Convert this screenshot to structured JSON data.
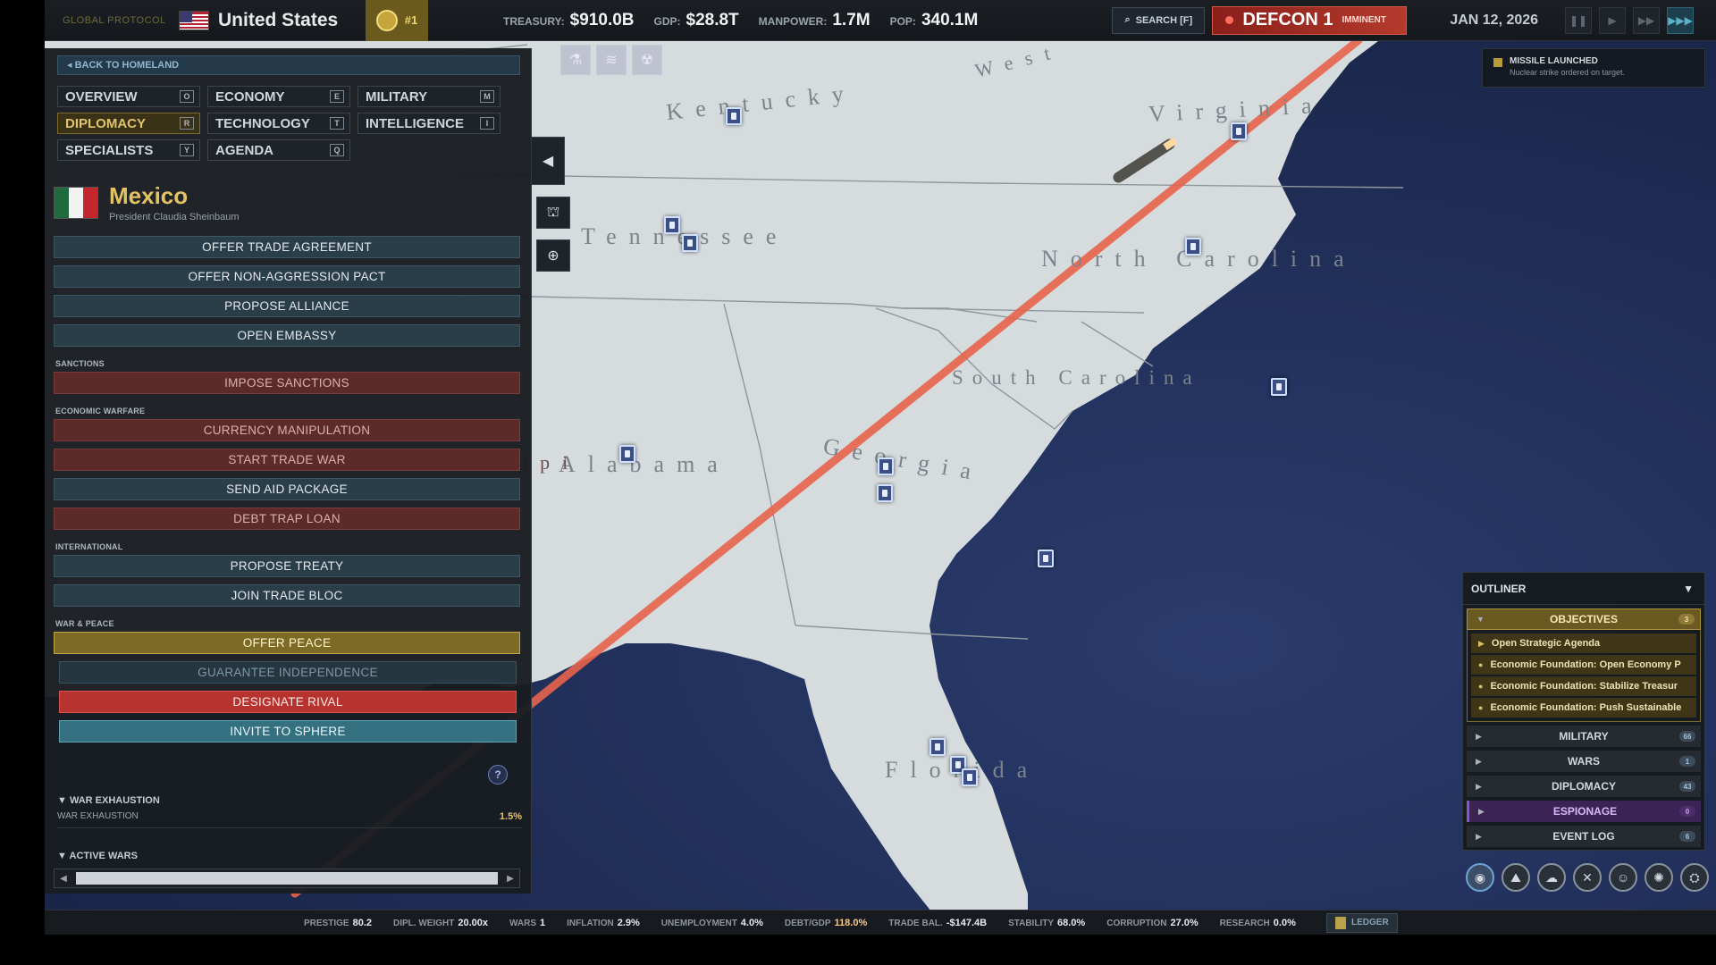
{
  "topbar": {
    "protocol": "GLOBAL PROTOCOL",
    "country": "United States",
    "rank": "#1",
    "stats": [
      {
        "label": "TREASURY:",
        "value": "$910.0B"
      },
      {
        "label": "GDP:",
        "value": "$28.8T"
      },
      {
        "label": "MANPOWER:",
        "value": "1.7M"
      },
      {
        "label": "POP:",
        "value": "340.1M"
      }
    ],
    "search": "SEARCH [F]",
    "defcon_level": "DEFCON 1",
    "defcon_status": "IMMINENT",
    "date": "JAN 12, 2026"
  },
  "panel": {
    "back": "BACK TO HOMELAND",
    "tabs": [
      {
        "label": "OVERVIEW",
        "key": "O"
      },
      {
        "label": "ECONOMY",
        "key": "E"
      },
      {
        "label": "MILITARY",
        "key": "M"
      },
      {
        "label": "DIPLOMACY",
        "key": "R"
      },
      {
        "label": "TECHNOLOGY",
        "key": "T"
      },
      {
        "label": "INTELLIGENCE",
        "key": "I"
      },
      {
        "label": "SPECIALISTS",
        "key": "Y"
      },
      {
        "label": "AGENDA",
        "key": "Q"
      }
    ],
    "country_name": "Mexico",
    "leader": "President Claudia Sheinbaum",
    "actions": {
      "trade": "OFFER TRADE AGREEMENT",
      "nap": "OFFER NON-AGGRESSION PACT",
      "alliance": "PROPOSE ALLIANCE",
      "embassy": "OPEN EMBASSY",
      "sec_sanctions": "SANCTIONS",
      "sanctions": "IMPOSE SANCTIONS",
      "sec_econ": "ECONOMIC WARFARE",
      "currency": "CURRENCY MANIPULATION",
      "trade_war": "START TRADE WAR",
      "aid": "SEND AID PACKAGE",
      "debt_trap": "DEBT TRAP LOAN",
      "sec_intl": "INTERNATIONAL",
      "treaty": "PROPOSE TREATY",
      "trade_bloc": "JOIN TRADE BLOC",
      "sec_war": "WAR & PEACE",
      "peace": "OFFER PEACE",
      "guarantee": "GUARANTEE INDEPENDENCE",
      "rival": "DESIGNATE RIVAL",
      "sphere": "INVITE TO SPHERE"
    },
    "help": "?",
    "war_exhaustion_head": "WAR EXHAUSTION",
    "war_exhaustion_label": "WAR EXHAUSTION",
    "war_exhaustion_value": "1.5%",
    "active_wars_head": "ACTIVE WARS"
  },
  "map": {
    "states": [
      "Kentucky",
      "Virginia",
      "West",
      "Tennessee",
      "North Carolina",
      "South Carolina",
      "Alabama",
      "Georgia",
      "Florida",
      "Mississippi"
    ]
  },
  "notification": {
    "title": "MISSILE LAUNCHED",
    "body": "Nuclear strike ordered on target."
  },
  "outliner": {
    "title": "OUTLINER",
    "objectives": {
      "label": "OBJECTIVES",
      "count": "3"
    },
    "objective_items": [
      "Open Strategic Agenda",
      "Economic Foundation: Open Economy P",
      "Economic Foundation: Stabilize Treasur",
      "Economic Foundation: Push Sustainable"
    ],
    "sections": [
      {
        "label": "MILITARY",
        "count": "66"
      },
      {
        "label": "WARS",
        "count": "1"
      },
      {
        "label": "DIPLOMACY",
        "count": "43"
      },
      {
        "label": "ESPIONAGE",
        "count": "0"
      },
      {
        "label": "EVENT LOG",
        "count": "6"
      }
    ]
  },
  "statusbar": [
    {
      "label": "PRESTIGE",
      "value": "80.2"
    },
    {
      "label": "DIPL. WEIGHT",
      "value": "20.00x"
    },
    {
      "label": "WARS",
      "value": "1"
    },
    {
      "label": "INFLATION",
      "value": "2.9%"
    },
    {
      "label": "UNEMPLOYMENT",
      "value": "4.0%"
    },
    {
      "label": "DEBT/GDP",
      "value": "118.0%"
    },
    {
      "label": "TRADE BAL.",
      "value": "-$147.4B"
    },
    {
      "label": "STABILITY",
      "value": "68.0%"
    },
    {
      "label": "CORRUPTION",
      "value": "27.0%"
    },
    {
      "label": "RESEARCH",
      "value": "0.0%"
    }
  ],
  "ledger": "LEDGER",
  "colors": {
    "accent_gold": "#e2c262",
    "missile_trail": "#e8644c",
    "defcon_red": "#b43a2c",
    "ocean": "#1d2c55",
    "land": "#d7dcde"
  }
}
